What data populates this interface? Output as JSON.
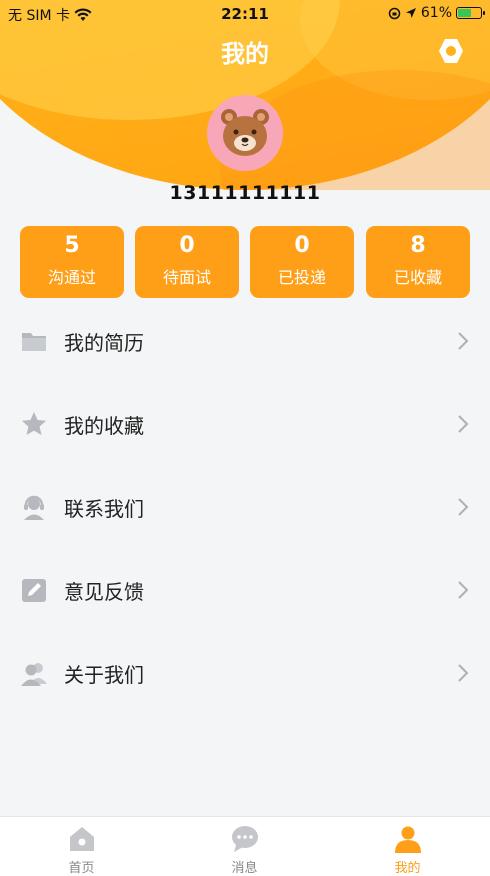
{
  "status_bar": {
    "carrier": "无 SIM 卡",
    "time": "22:11",
    "battery": "61%",
    "battery_level": 0.61
  },
  "header": {
    "title": "我的"
  },
  "profile": {
    "phone": "13111111111"
  },
  "stats": [
    {
      "value": "5",
      "label": "沟通过"
    },
    {
      "value": "0",
      "label": "待面试"
    },
    {
      "value": "0",
      "label": "已投递"
    },
    {
      "value": "8",
      "label": "已收藏"
    }
  ],
  "menu": [
    {
      "label": "我的简历",
      "icon": "folder-icon"
    },
    {
      "label": "我的收藏",
      "icon": "star-icon"
    },
    {
      "label": "联系我们",
      "icon": "headset-icon"
    },
    {
      "label": "意见反馈",
      "icon": "edit-icon"
    },
    {
      "label": "关于我们",
      "icon": "users-icon"
    }
  ],
  "tabs": [
    {
      "label": "首页",
      "icon": "home-icon"
    },
    {
      "label": "消息",
      "icon": "chat-icon"
    },
    {
      "label": "我的",
      "icon": "person-icon",
      "active": true
    }
  ],
  "colors": {
    "accent": "#ff9f18",
    "header_gradient_top": "#ffc21f",
    "icon_gray": "#b5b8bd"
  }
}
